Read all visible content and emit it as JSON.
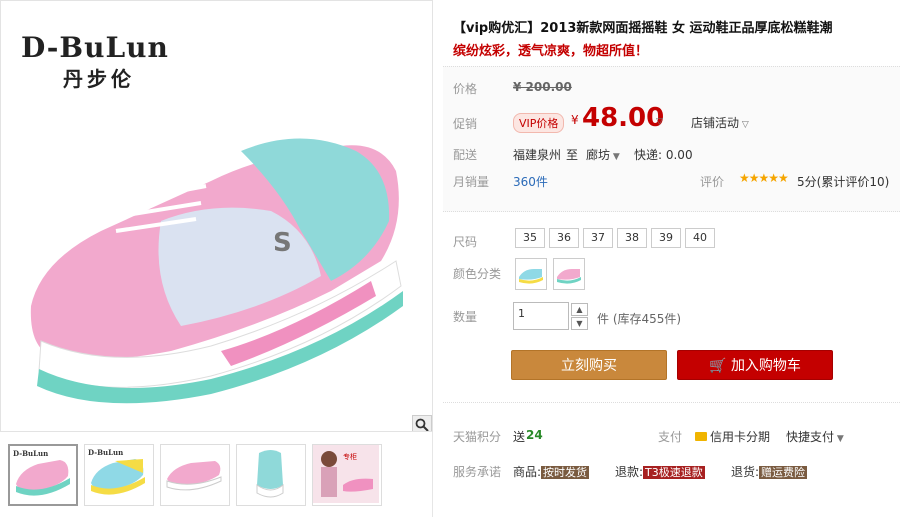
{
  "gallery": {
    "brand_en": "D-BuLun",
    "brand_cn": "丹步伦",
    "zoom_icon": "magnifier-icon",
    "thumbnails": [
      "pink-sneaker",
      "yellow-blue-sneaker",
      "pink-white-sneaker",
      "teal-sneaker",
      "model-photo"
    ]
  },
  "product": {
    "title": "【vip购优汇】2013新款网面摇摇鞋 女 运动鞋正品厚底松糕鞋潮",
    "subtitle": "缤纷炫彩，透气凉爽，物超所值！"
  },
  "price": {
    "label": "价格",
    "original": "¥ 200.00",
    "promo_label": "促销",
    "vip_badge": "VIP价格",
    "currency": "¥",
    "value": "48.00",
    "store_activity": "店铺活动"
  },
  "shipping": {
    "label": "配送",
    "from": "福建泉州",
    "to_word": "至",
    "to": "廊坊",
    "express": "快递: 0.00"
  },
  "sales": {
    "label": "月销量",
    "count": "360件",
    "rating_label": "评价",
    "stars": "★★★★★",
    "rating": "5分(累计评价10)"
  },
  "size": {
    "label": "尺码",
    "options": [
      "35",
      "36",
      "37",
      "38",
      "39",
      "40"
    ]
  },
  "color": {
    "label": "颜色分类"
  },
  "quantity": {
    "label": "数量",
    "value": "1",
    "unit": "件 (库存455件)"
  },
  "actions": {
    "buy_now": "立刻购买",
    "add_cart": "加入购物车"
  },
  "points": {
    "label": "天猫积分",
    "give_word": "送",
    "value": "24",
    "pay_label": "支付",
    "credit": "信用卡分期",
    "quick_pay": "快捷支付"
  },
  "service": {
    "label": "服务承诺",
    "goods": "商品:",
    "goods_badge": "按时发货",
    "refund": "退款:",
    "refund_badge": "T3极速退款",
    "return": "退货:",
    "return_badge": "赠运费险"
  },
  "colors_accent": {
    "red": "#c40000",
    "orange": "#c9883c"
  }
}
